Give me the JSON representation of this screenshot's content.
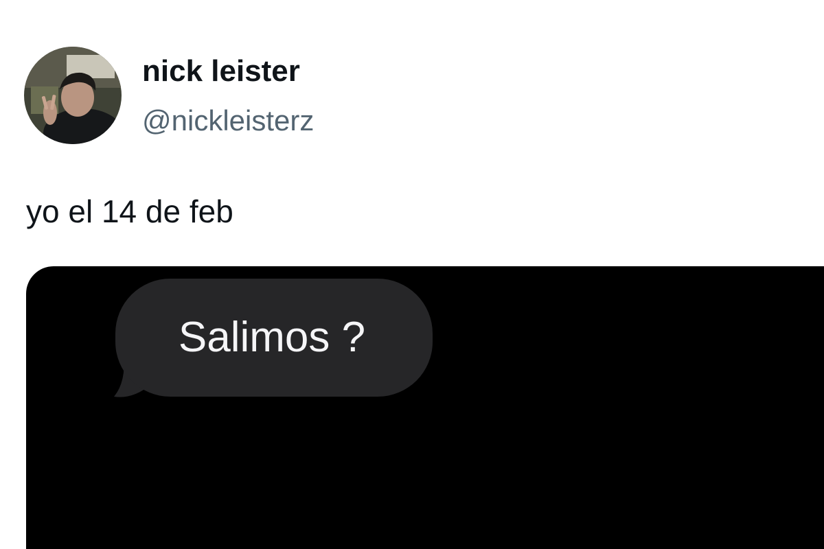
{
  "tweet": {
    "author": {
      "display_name": "nick leister",
      "handle": "@nickleisterz",
      "avatar": "profile-photo"
    },
    "text": "yo el 14 de feb",
    "media": {
      "type": "message-screenshot",
      "background": "#000000",
      "message": {
        "text": "Salimos ?",
        "bubble_color": "#262628",
        "text_color": "#f5f5f7"
      }
    }
  }
}
